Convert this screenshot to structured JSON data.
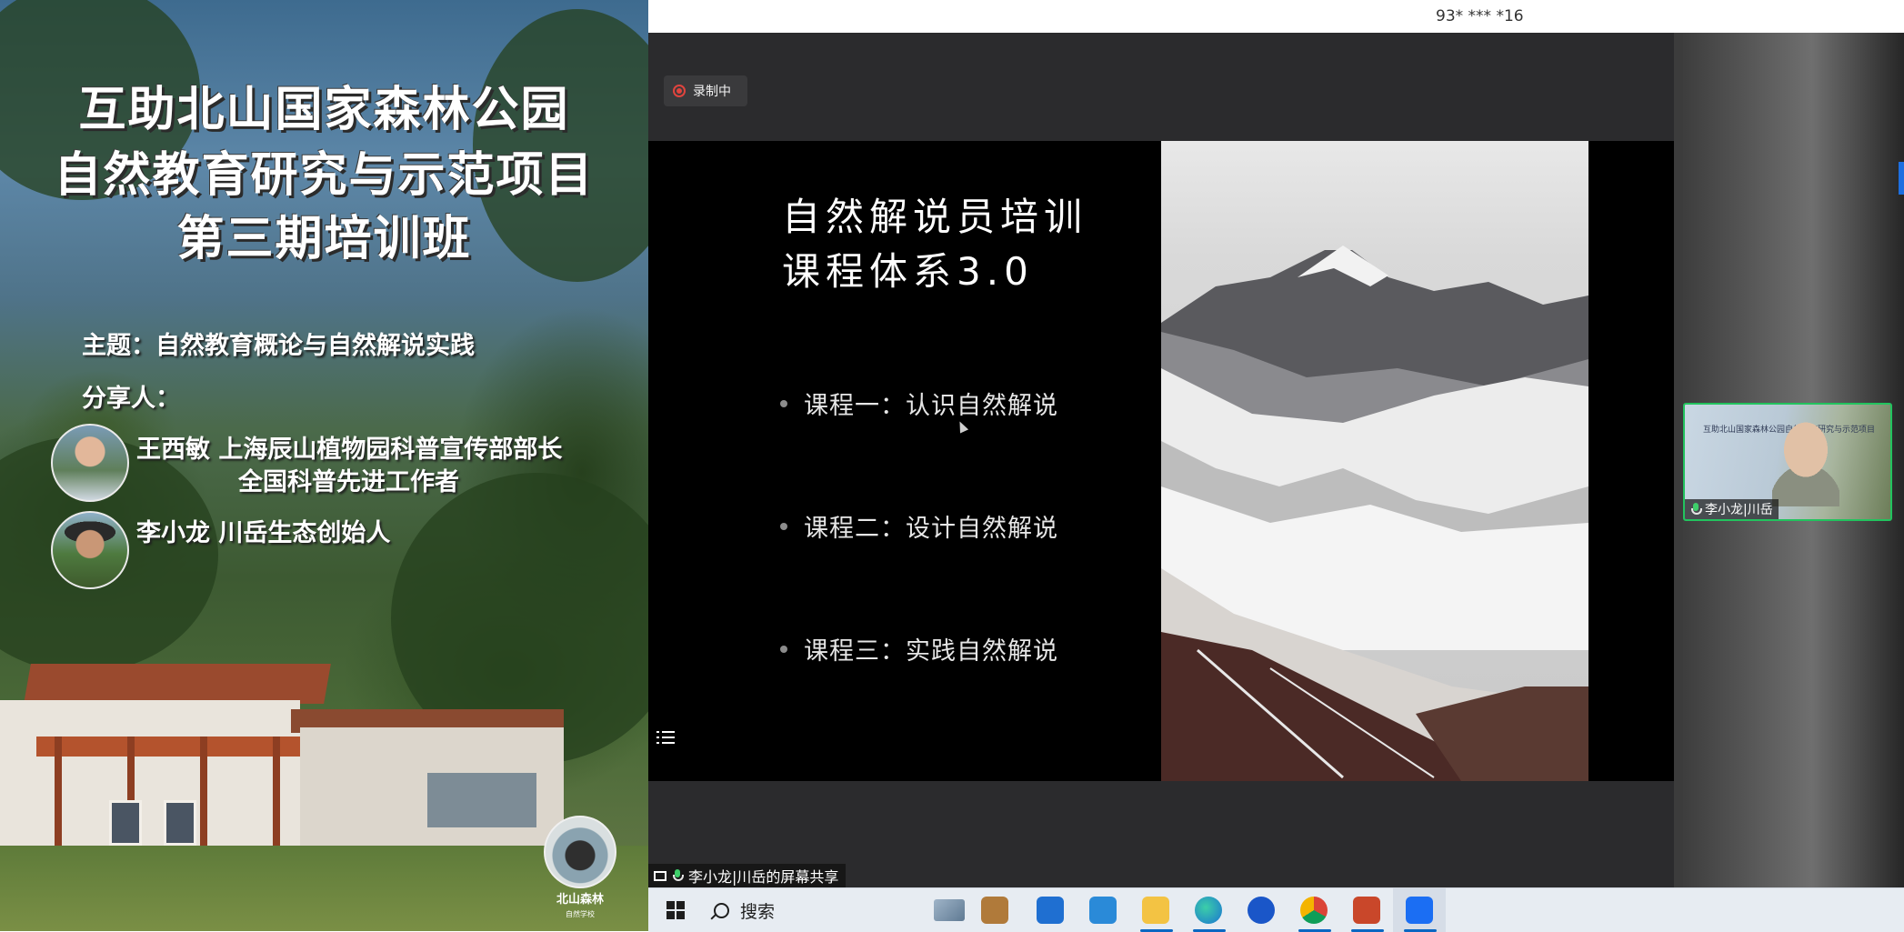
{
  "poster": {
    "title_line1": "互助北山国家森林公园",
    "title_line2": "自然教育研究与示范项目",
    "title_line3": "第三期培训班",
    "theme": "主题：自然教育概论与自然解说实践",
    "speakers_label": "分享人：",
    "speaker1_line1": "王西敏  上海辰山植物园科普宣传部部长",
    "speaker1_line2": "全国科普先进工作者",
    "speaker2": "李小龙  川岳生态创始人",
    "logo_text": "北山森林",
    "logo_subtext": "自然学校"
  },
  "meeting": {
    "meeting_id": "93* *** *16",
    "recording_label": "录制中",
    "share_label": "李小龙|川岳的屏幕共享",
    "participant_name": "李小龙|川岳",
    "thumbnail_caption": "互助北山国家森林公园自然教育研究与示范项目"
  },
  "slide": {
    "title_line1": "自然解说员培训",
    "title_line2": "课程体系3.0",
    "bullets": [
      "课程一：认识自然解说",
      "课程二：设计自然解说",
      "课程三：实践自然解说"
    ]
  },
  "taskbar": {
    "search_placeholder": "搜索",
    "apps": [
      "task-view",
      "file-explorer-briefcase",
      "store",
      "mail",
      "file-explorer",
      "edge",
      "lenovo",
      "chrome",
      "powerpoint",
      "tencent-meeting"
    ]
  },
  "colors": {
    "recording_red": "#e0443e",
    "speaker_border_green": "#22c35e",
    "taskbar_bg": "#e7ecf2",
    "meeting_bg": "#2b2b2d"
  }
}
